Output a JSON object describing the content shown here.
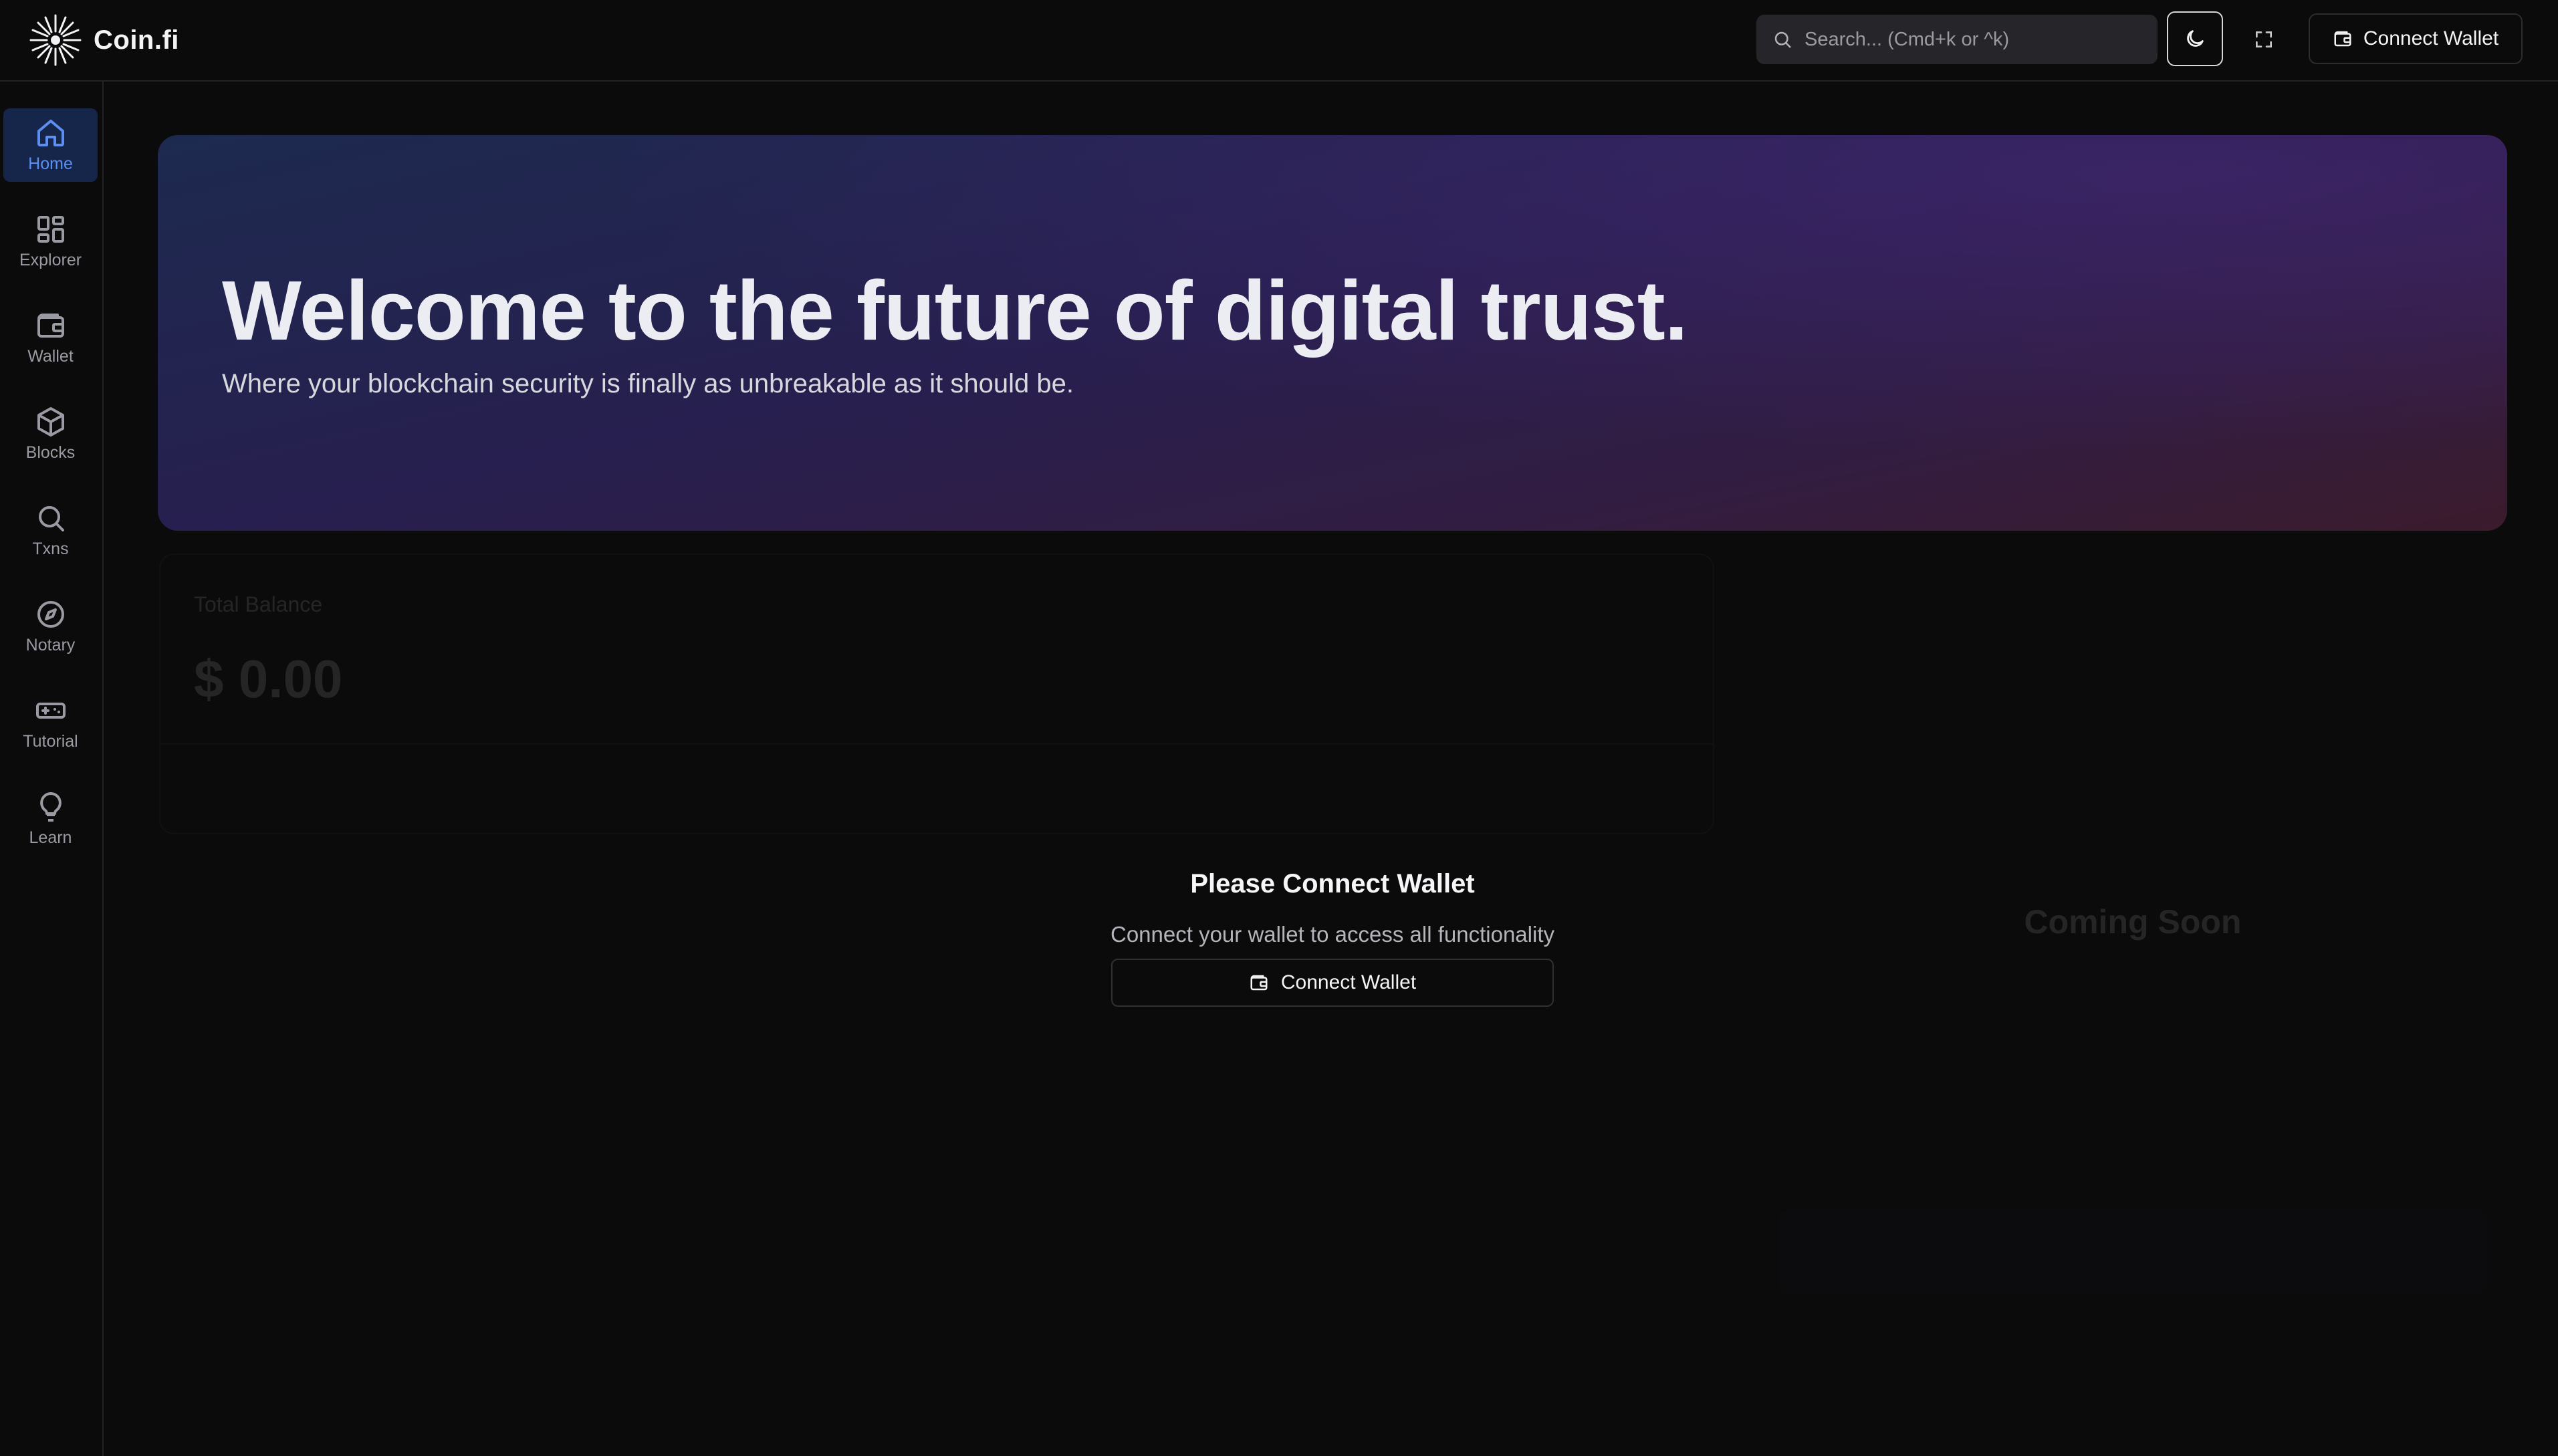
{
  "app": {
    "name": "Coin.fi"
  },
  "header": {
    "search_placeholder": "Search... (Cmd+k or ^k)",
    "connect_label": "Connect Wallet"
  },
  "sidebar": {
    "items": [
      {
        "label": "Home",
        "icon": "home-icon",
        "active": true
      },
      {
        "label": "Explorer",
        "icon": "grid-icon",
        "active": false
      },
      {
        "label": "Wallet",
        "icon": "wallet-icon",
        "active": false
      },
      {
        "label": "Blocks",
        "icon": "cube-icon",
        "active": false
      },
      {
        "label": "Txns",
        "icon": "search-icon",
        "active": false
      },
      {
        "label": "Notary",
        "icon": "compass-icon",
        "active": false
      },
      {
        "label": "Tutorial",
        "icon": "gamepad-icon",
        "active": false
      },
      {
        "label": "Learn",
        "icon": "lightbulb-icon",
        "active": false
      }
    ]
  },
  "hero": {
    "title": "Welcome to the future of digital trust.",
    "subtitle": "Where your blockchain security is finally as unbreakable as it should be."
  },
  "balance": {
    "label": "Total Balance",
    "value": "$ 0.00"
  },
  "prompt": {
    "title": "Please Connect Wallet",
    "subtitle": "Connect your wallet to access all functionality",
    "button_label": "Connect Wallet"
  },
  "panel": {
    "heading": "Coming Soon"
  },
  "colors": {
    "background": "#0b0b0c",
    "accent": "#5c8ff0",
    "active_nav_bg": "#16254a"
  }
}
